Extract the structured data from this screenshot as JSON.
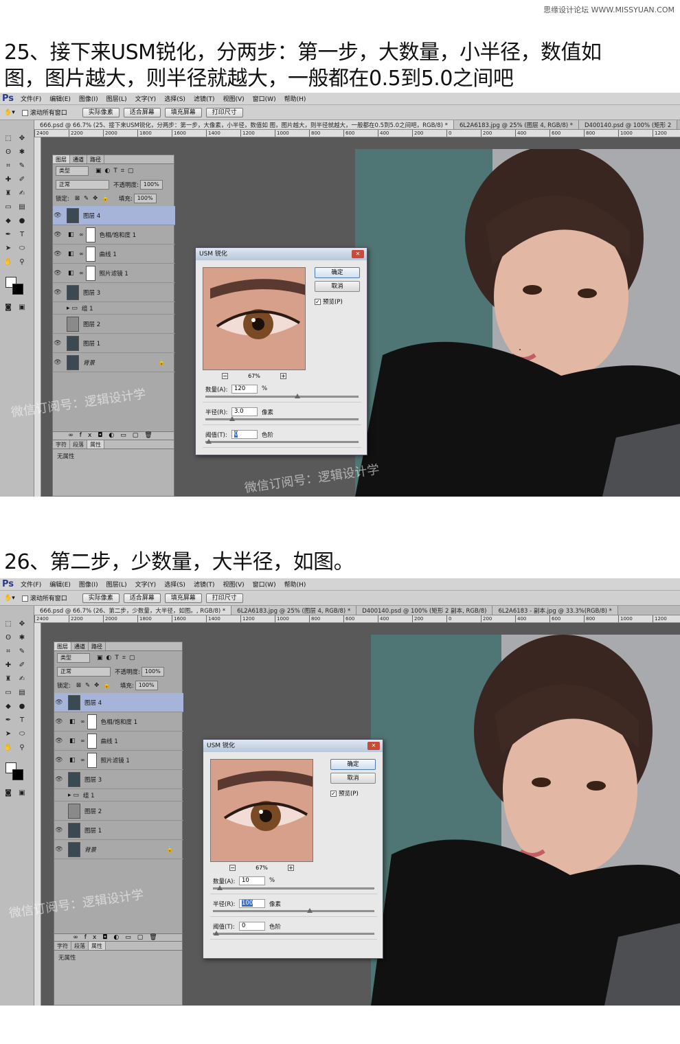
{
  "source_tag": "思缘设计论坛 WWW.MISSYUAN.COM",
  "step25": {
    "caption_line1": "25、接下来USM锐化，分两步：第一步，大数量，小半径，数值如",
    "caption_line2": "图，图片越大，则半径就越大，一般都在0.5到5.0之间吧",
    "tabs": [
      "666.psd @ 66.7% (25、接下来USM锐化，分两步：第一步，大像素，小半径，数值如 图，图片越大，则半径就越大，一般都在0.5到5.0之间吧，RGB/8) *",
      "6L2A6183.jpg @ 25% (图层 4, RGB/8) *",
      "D400140.psd @ 100% (矩形 2"
    ],
    "dialog": {
      "amount": "120",
      "radius": "3.0",
      "threshold": "0",
      "zoom": "67%"
    },
    "watermark": "微信订阅号：逻辑设计学"
  },
  "step26": {
    "caption": "26、第二步，少数量，大半径，如图。",
    "tabs": [
      "666.psd @ 66.7% (26、第二步，少数量，大半径，如图。, RGB/8) *",
      "6L2A6183.jpg @ 25% (图层 4, RGB/8) *",
      "D400140.psd @ 100% (矩形 2 副本, RGB/8)",
      "6L2A6183 - 副本.jpg @ 33.3%(RGB/8) *"
    ],
    "dialog": {
      "amount": "10",
      "radius": "100",
      "threshold": "0",
      "zoom": "67%"
    },
    "watermark": "微信订阅号：逻辑设计学"
  },
  "app": {
    "logo": "Ps",
    "menus": [
      "文件(F)",
      "编辑(E)",
      "图像(I)",
      "图层(L)",
      "文字(Y)",
      "选择(S)",
      "滤镜(T)",
      "视图(V)",
      "窗口(W)",
      "帮助(H)"
    ],
    "option_checkbox": "滚动所有窗口",
    "option_buttons": [
      "实际像素",
      "适合屏幕",
      "填充屏幕",
      "打印尺寸"
    ],
    "ruler_ticks": [
      "2400",
      "2200",
      "2000",
      "1800",
      "1600",
      "1400",
      "1200",
      "1000",
      "800",
      "600",
      "400",
      "200",
      "0",
      "200",
      "400",
      "600",
      "800",
      "1000",
      "1200",
      "1400",
      "1600",
      "1800",
      "2000"
    ]
  },
  "layers_panel": {
    "tabs": [
      "图层",
      "通道",
      "路径"
    ],
    "filter_label": "类型",
    "blend_mode": "正常",
    "opacity_label": "不透明度:",
    "opacity_value": "100%",
    "lock_label": "锁定:",
    "fill_label": "填充:",
    "fill_value": "100%",
    "layers": [
      "图层 4",
      "色相/饱和度 1",
      "曲线 1",
      "照片滤镜 1",
      "图层 3",
      "组 1",
      "图层 2",
      "图层 1",
      "背景"
    ],
    "bottom_tabs": [
      "字符",
      "段落",
      "属性"
    ],
    "no_properties": "无属性"
  },
  "dialog_common": {
    "title": "USM 锐化",
    "ok": "确定",
    "cancel": "取消",
    "preview": "预览(P)",
    "amount_label": "数量(A):",
    "amount_unit": "%",
    "radius_label": "半径(R):",
    "radius_unit": "像素",
    "threshold_label": "阈值(T):",
    "threshold_unit": "色阶"
  }
}
